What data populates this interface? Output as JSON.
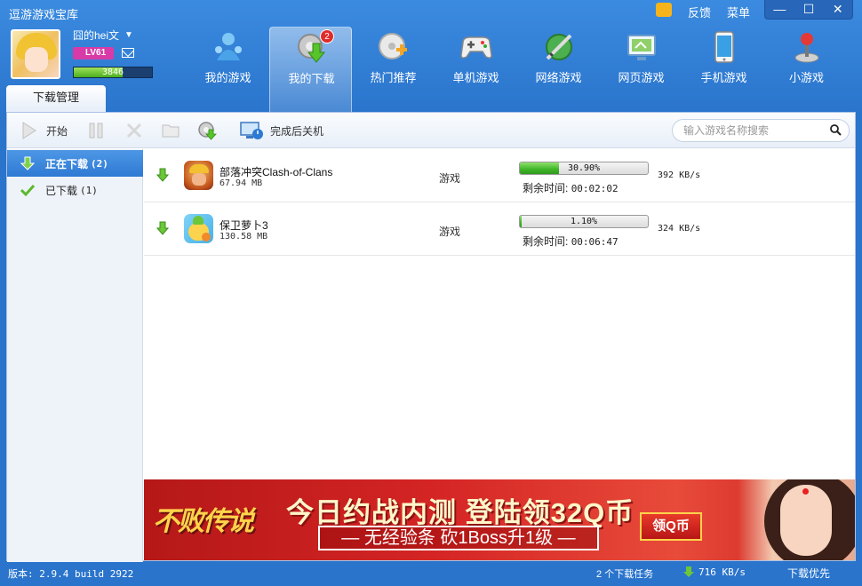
{
  "window": {
    "title": "逗游游戏宝库",
    "feedback": "反馈",
    "menu": "菜单",
    "minimize": "—",
    "maximize": "☐",
    "close": "✕"
  },
  "user": {
    "name": "囧的hei文",
    "level": "LV61",
    "exp_text": "3846",
    "exp_percent": 62
  },
  "nav": {
    "items": [
      {
        "label": "我的游戏"
      },
      {
        "label": "我的下载",
        "badge": "2"
      },
      {
        "label": "热门推荐"
      },
      {
        "label": "单机游戏"
      },
      {
        "label": "网络游戏"
      },
      {
        "label": "网页游戏"
      },
      {
        "label": "手机游戏"
      },
      {
        "label": "小游戏"
      }
    ]
  },
  "tab": {
    "label": "下载管理"
  },
  "toolbar": {
    "start": "开始",
    "shutdown": "完成后关机",
    "search_placeholder": "输入游戏名称搜索"
  },
  "sidebar": {
    "downloading": "正在下载",
    "downloading_count": "(2)",
    "downloaded": "已下载",
    "downloaded_count": "(1)"
  },
  "downloads": [
    {
      "name": "部落冲突Clash-of-Clans",
      "size": "67.94 MB",
      "type": "游戏",
      "progress_text": "30.90%",
      "progress": 30.9,
      "remain_label": "剩余时间:",
      "remain": "00:02:02",
      "speed": "392 KB/s"
    },
    {
      "name": "保卫萝卜3",
      "size": "130.58 MB",
      "type": "游戏",
      "progress_text": "1.10%",
      "progress": 1.1,
      "remain_label": "剩余时间:",
      "remain": "00:06:47",
      "speed": "324 KB/s"
    }
  ],
  "banner": {
    "logo": "不败传说",
    "headline": "今日约战内测 登陆领32Q币",
    "sub": "— 无经验条 砍1Boss升1级 —",
    "button": "领Q币"
  },
  "status": {
    "version": "版本: 2.9.4 build 2922",
    "tasks": "2 个下载任务",
    "speed": "716 KB/s",
    "priority": "下载优先"
  },
  "colors": {
    "accent": "#2e7ad3",
    "progress": "#3fb528",
    "badge": "#e02b2b"
  }
}
